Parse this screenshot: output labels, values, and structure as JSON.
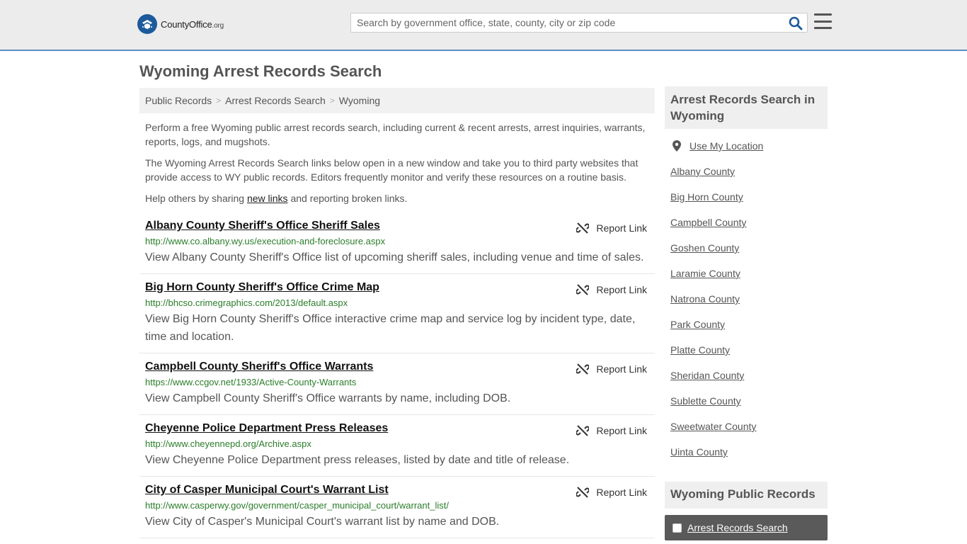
{
  "header": {
    "logo_main": "CountyOffice",
    "logo_org": ".org",
    "search_placeholder": "Search by government office, state, county, city or zip code"
  },
  "page_title": "Wyoming Arrest Records Search",
  "breadcrumb": [
    "Public Records",
    "Arrest Records Search",
    "Wyoming"
  ],
  "intro": {
    "p1": "Perform a free Wyoming public arrest records search, including current & recent arrests, arrest inquiries, warrants, reports, logs, and mugshots.",
    "p2": "The Wyoming Arrest Records Search links below open in a new window and take you to third party websites that provide access to WY public records. Editors frequently monitor and verify these resources on a routine basis.",
    "p3_before": "Help others by sharing ",
    "p3_link": "new links",
    "p3_after": " and reporting broken links."
  },
  "report_link_label": "Report Link",
  "listings": [
    {
      "title": "Albany County Sheriff's Office Sheriff Sales",
      "url": "http://www.co.albany.wy.us/execution-and-foreclosure.aspx",
      "desc": "View Albany County Sheriff's Office list of upcoming sheriff sales, including venue and time of sales."
    },
    {
      "title": "Big Horn County Sheriff's Office Crime Map",
      "url": "http://bhcso.crimegraphics.com/2013/default.aspx",
      "desc": "View Big Horn County Sheriff's Office interactive crime map and service log by incident type, date, time and location."
    },
    {
      "title": "Campbell County Sheriff's Office Warrants",
      "url": "https://www.ccgov.net/1933/Active-County-Warrants",
      "desc": "View Campbell County Sheriff's Office warrants by name, including DOB."
    },
    {
      "title": "Cheyenne Police Department Press Releases",
      "url": "http://www.cheyennepd.org/Archive.aspx",
      "desc": "View Cheyenne Police Department press releases, listed by date and title of release."
    },
    {
      "title": "City of Casper Municipal Court's Warrant List",
      "url": "http://www.casperwy.gov/government/casper_municipal_court/warrant_list/",
      "desc": "View City of Casper's Municipal Court's warrant list by name and DOB."
    }
  ],
  "sidebar": {
    "heading": "Arrest Records Search in Wyoming",
    "use_location": "Use My Location",
    "counties": [
      "Albany County",
      "Big Horn County",
      "Campbell County",
      "Goshen County",
      "Laramie County",
      "Natrona County",
      "Park County",
      "Platte County",
      "Sheridan County",
      "Sublette County",
      "Sweetwater County",
      "Uinta County"
    ],
    "heading2": "Wyoming Public Records",
    "active_item": "Arrest Records Search"
  }
}
